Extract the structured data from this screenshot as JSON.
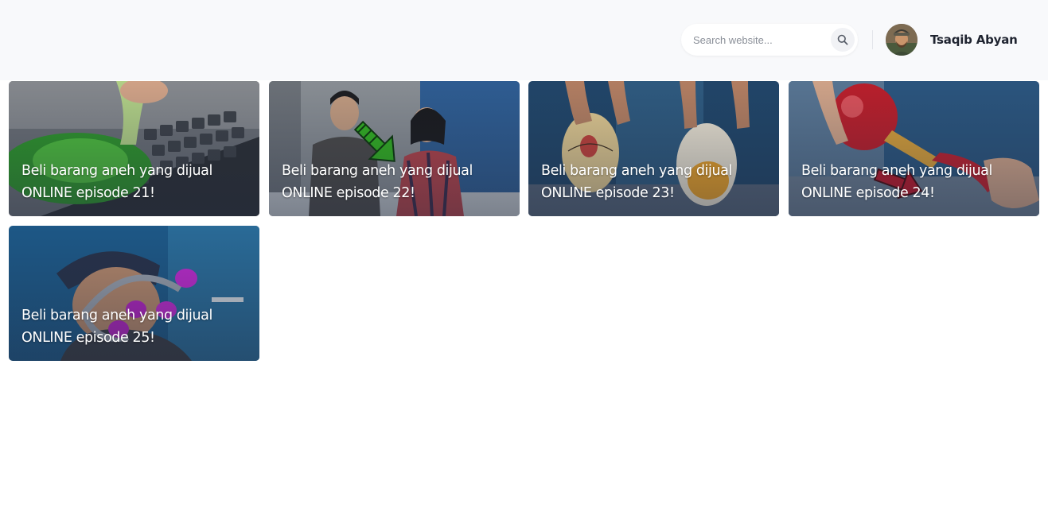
{
  "header": {
    "search": {
      "placeholder": "Search website...",
      "value": ""
    },
    "user": {
      "name": "Tsaqib Abyan"
    }
  },
  "videos": [
    {
      "title_line1": "Beli barang aneh yang dijual",
      "title_line2": "ONLINE episode 21!"
    },
    {
      "title_line1": "Beli barang aneh yang dijual",
      "title_line2": "ONLINE episode 22!"
    },
    {
      "title_line1": "Beli barang aneh yang dijual",
      "title_line2": "ONLINE episode 23!"
    },
    {
      "title_line1": "Beli barang aneh yang dijual",
      "title_line2": "ONLINE episode 24!"
    },
    {
      "title_line1": "Beli barang aneh yang dijual",
      "title_line2": "ONLINE episode 25!"
    }
  ],
  "colors": {
    "topbar_bg": "#f8f9fb",
    "card_overlay": "#1e283c"
  }
}
